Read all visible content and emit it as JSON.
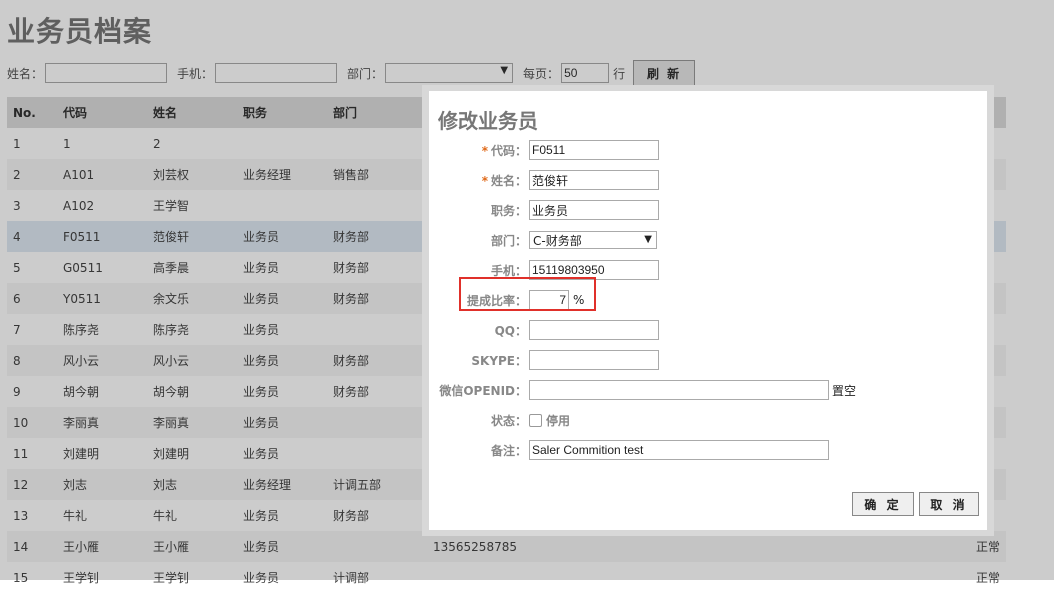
{
  "page": {
    "title": "业务员档案",
    "filters": {
      "name_label": "姓名：",
      "name_value": "",
      "phone_label": "手机：",
      "phone_value": "",
      "dept_label": "部门：",
      "dept_value": "",
      "perpage_label": "每页：",
      "perpage_value": "50",
      "rows_unit": "行",
      "refresh_label": "刷 新"
    },
    "table": {
      "columns": [
        "No.",
        "代码",
        "姓名",
        "职务",
        "部门"
      ],
      "rows": [
        {
          "no": "1",
          "code": "1",
          "name": "2",
          "title": "",
          "dept": "",
          "phone": "",
          "status": ""
        },
        {
          "no": "2",
          "code": "A101",
          "name": "刘芸权",
          "title": "业务经理",
          "dept": "销售部",
          "phone": "",
          "status": ""
        },
        {
          "no": "3",
          "code": "A102",
          "name": "王学智",
          "title": "",
          "dept": "",
          "phone": "",
          "status": ""
        },
        {
          "no": "4",
          "code": "F0511",
          "name": "范俊轩",
          "title": "业务员",
          "dept": "财务部",
          "phone": "",
          "status": ""
        },
        {
          "no": "5",
          "code": "G0511",
          "name": "高季晨",
          "title": "业务员",
          "dept": "财务部",
          "phone": "",
          "status": ""
        },
        {
          "no": "6",
          "code": "Y0511",
          "name": "余文乐",
          "title": "业务员",
          "dept": "财务部",
          "phone": "",
          "status": ""
        },
        {
          "no": "7",
          "code": "陈序尧",
          "name": "陈序尧",
          "title": "业务员",
          "dept": "",
          "phone": "",
          "status": ""
        },
        {
          "no": "8",
          "code": "风小云",
          "name": "风小云",
          "title": "业务员",
          "dept": "财务部",
          "phone": "",
          "status": ""
        },
        {
          "no": "9",
          "code": "胡今朝",
          "name": "胡今朝",
          "title": "业务员",
          "dept": "财务部",
          "phone": "",
          "status": ""
        },
        {
          "no": "10",
          "code": "李丽真",
          "name": "李丽真",
          "title": "业务员",
          "dept": "",
          "phone": "",
          "status": ""
        },
        {
          "no": "11",
          "code": "刘建明",
          "name": "刘建明",
          "title": "业务员",
          "dept": "",
          "phone": "",
          "status": ""
        },
        {
          "no": "12",
          "code": "刘志",
          "name": "刘志",
          "title": "业务经理",
          "dept": "计调五部",
          "phone": "",
          "status": ""
        },
        {
          "no": "13",
          "code": "牛礼",
          "name": "牛礼",
          "title": "业务员",
          "dept": "财务部",
          "phone": "",
          "status": ""
        },
        {
          "no": "14",
          "code": "王小雁",
          "name": "王小雁",
          "title": "业务员",
          "dept": "",
          "phone": "13565258785",
          "status": "正常"
        },
        {
          "no": "15",
          "code": "王学钊",
          "name": "王学钊",
          "title": "业务员",
          "dept": "计调部",
          "phone": "",
          "status": "正常"
        }
      ]
    }
  },
  "dialog": {
    "title": "修改业务员",
    "required_mark": "*",
    "code_label": "代码：",
    "code_value": "F0511",
    "name_label": "姓名：",
    "name_value": "范俊轩",
    "title_label": "职务：",
    "title_value": "业务员",
    "dept_label": "部门：",
    "dept_value": "C-财务部",
    "phone_label": "手机：",
    "phone_value": "15119803950",
    "ratio_label": "提成比率：",
    "ratio_value": "7",
    "ratio_unit": "%",
    "qq_label": "QQ：",
    "qq_value": "",
    "skype_label": "SKYPE：",
    "skype_value": "",
    "wechat_label": "微信OPENID：",
    "wechat_value": "",
    "clear_label": "置空",
    "status_label": "状态：",
    "status_option": "停用",
    "status_checked": false,
    "note_label": "备注：",
    "note_value": "Saler Commition test",
    "ok_label": "确 定",
    "cancel_label": "取 消",
    "highlight_color": "#e0302a"
  }
}
